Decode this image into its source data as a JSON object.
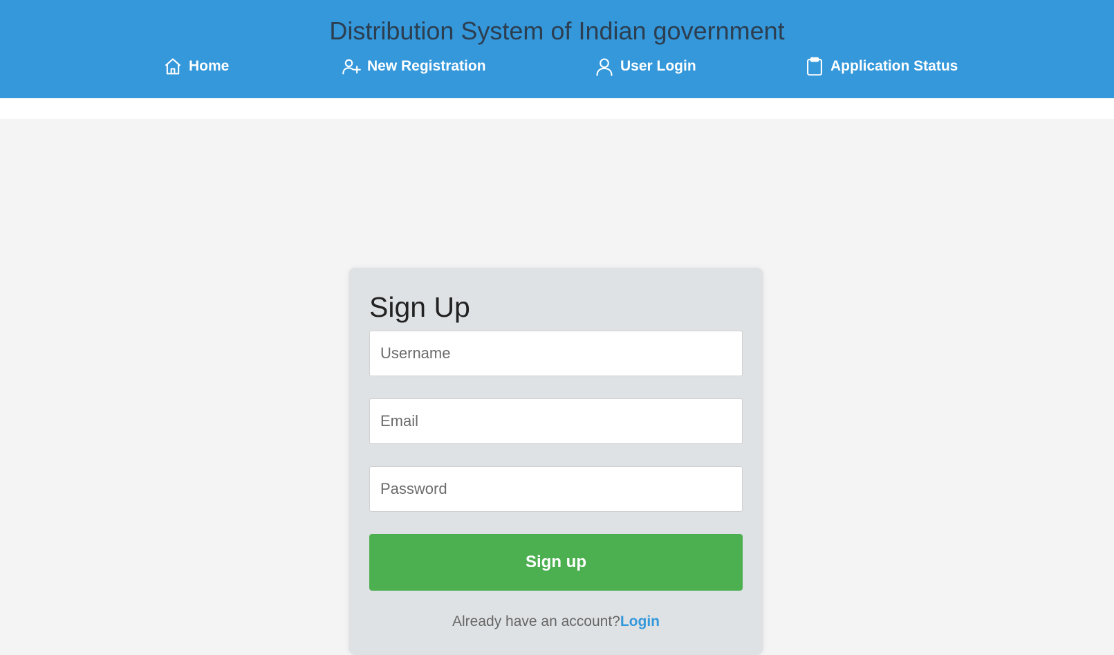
{
  "header": {
    "title": "Distribution System of Indian government",
    "background_color": "#3498db",
    "nav": [
      {
        "label": "Home",
        "icon": "home-icon"
      },
      {
        "label": "New Registration",
        "icon": "user-plus-icon"
      },
      {
        "label": "User Login",
        "icon": "user-icon"
      },
      {
        "label": "Application Status",
        "icon": "clipboard-icon"
      }
    ]
  },
  "form": {
    "title": "Sign Up",
    "fields": {
      "username_placeholder": "Username",
      "email_placeholder": "Email",
      "password_placeholder": "Password"
    },
    "submit_label": "Sign up",
    "submit_color": "#4caf50",
    "footer_text": "Already have an account?",
    "login_link": "Login"
  }
}
